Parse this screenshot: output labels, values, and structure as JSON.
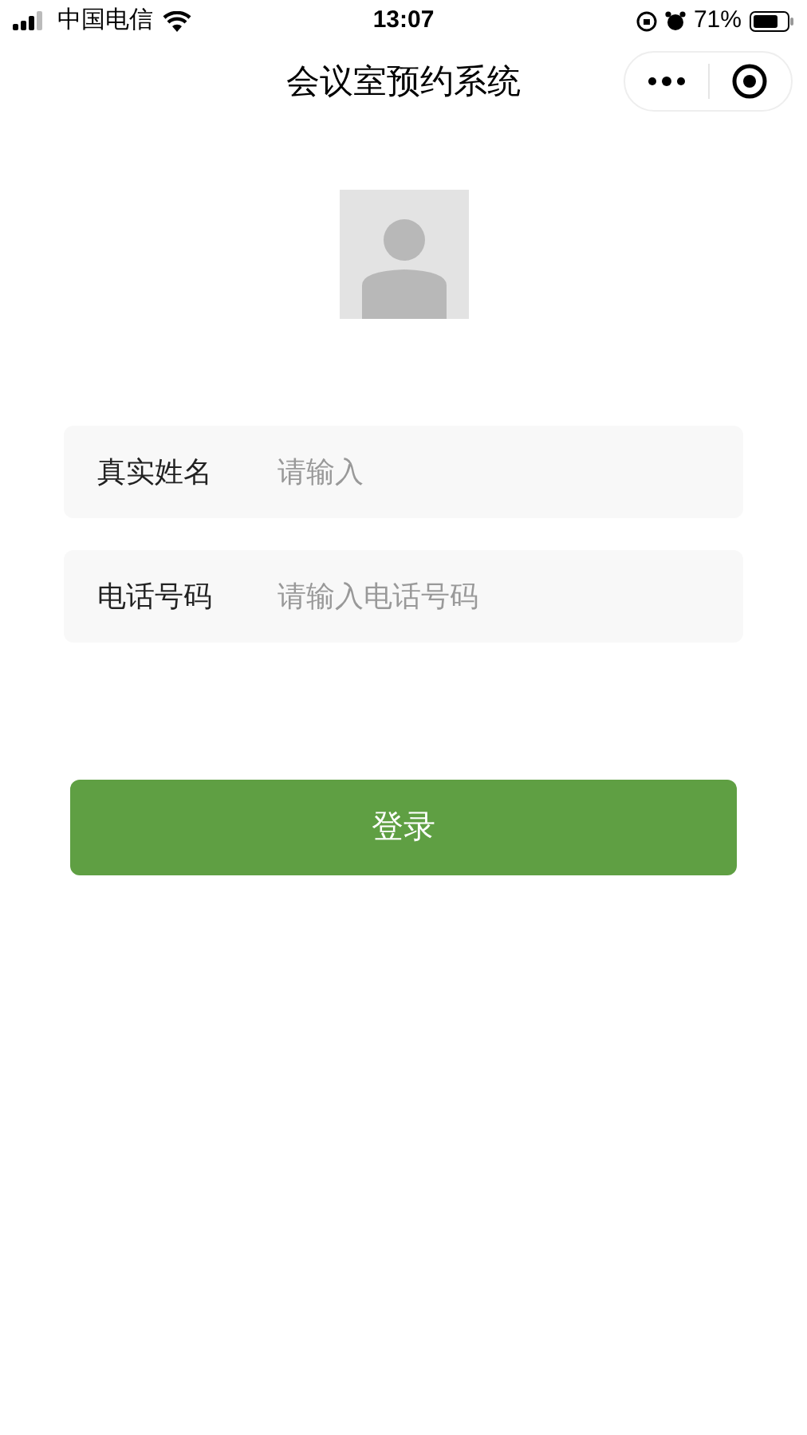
{
  "status_bar": {
    "carrier": "中国电信",
    "time": "13:07",
    "battery": "71%"
  },
  "nav": {
    "title": "会议室预约系统"
  },
  "form": {
    "fields": [
      {
        "label": "真实姓名",
        "placeholder": "请输入"
      },
      {
        "label": "电话号码",
        "placeholder": "请输入电话号码"
      }
    ]
  },
  "login_button": "登录"
}
